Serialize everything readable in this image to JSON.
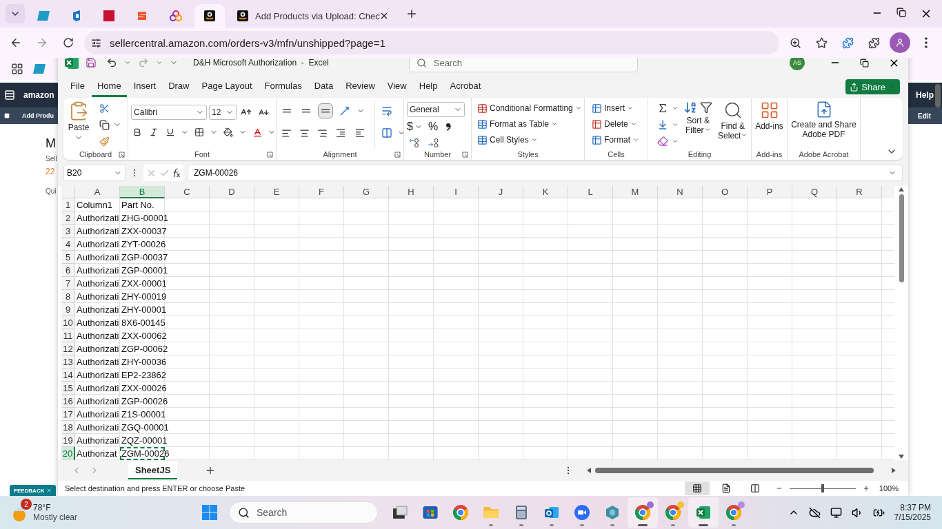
{
  "browser": {
    "tabs": [
      {
        "kind": "ec",
        "selected": false
      },
      {
        "kind": "g",
        "selected": false
      },
      {
        "kind": "dh",
        "selected": false
      },
      {
        "kind": "s",
        "selected": false
      },
      {
        "kind": "dots",
        "selected": false
      },
      {
        "kind": "amazon",
        "selected": true
      },
      {
        "kind": "amazon",
        "selected": false,
        "title": "Add Products via Upload: Chec"
      }
    ],
    "url": "sellercentral.amazon.com/orders-v3/mfn/unshipped?page=1"
  },
  "page": {
    "brand": "amazon",
    "nav_right": "Help",
    "subnav": "Add Produ",
    "subnav_right": "Edit",
    "heading": "M",
    "label": "Sell",
    "count": "22",
    "quick": "Qui",
    "feedback": "FEEDBACK"
  },
  "excel": {
    "title": "D&H Microsoft Authorization  -  Excel",
    "search_placeholder": "Search",
    "avatar": "AS",
    "menu": [
      {
        "label": "File",
        "selected": false
      },
      {
        "label": "Home",
        "selected": true
      },
      {
        "label": "Insert",
        "selected": false
      },
      {
        "label": "Draw",
        "selected": false
      },
      {
        "label": "Page Layout",
        "selected": false
      },
      {
        "label": "Formulas",
        "selected": false
      },
      {
        "label": "Data",
        "selected": false
      },
      {
        "label": "Review",
        "selected": false
      },
      {
        "label": "View",
        "selected": false
      },
      {
        "label": "Help",
        "selected": false
      },
      {
        "label": "Acrobat",
        "selected": false
      }
    ],
    "share": "Share",
    "ribbon": [
      {
        "kind": "clipboard",
        "label": "Clipboard",
        "button": "Paste"
      },
      {
        "kind": "font",
        "label": "Font",
        "font_name": "Calibri",
        "font_size": "12"
      },
      {
        "kind": "alignment",
        "label": "Alignment"
      },
      {
        "kind": "number",
        "label": "Number",
        "format": "General",
        "currency": "$",
        "percent": "%"
      },
      {
        "kind": "styles",
        "label": "Styles",
        "items": [
          "Conditional Formatting",
          "Format as Table",
          "Cell Styles"
        ]
      },
      {
        "kind": "cells",
        "label": "Cells",
        "items": [
          "Insert",
          "Delete",
          "Format"
        ]
      },
      {
        "kind": "editing",
        "label": "Editing",
        "items": [
          "Sort & Filter",
          "Find & Select"
        ]
      },
      {
        "kind": "addins",
        "label": "Add-ins",
        "button": "Add-ins"
      },
      {
        "kind": "acrobat",
        "label": "Adobe Acrobat",
        "button": "Create and Share Adobe PDF"
      }
    ],
    "name_box": "B20",
    "formula": "ZGM-00026",
    "columns": [
      {
        "label": "A",
        "selected": false
      },
      {
        "label": "B",
        "selected": true
      },
      {
        "label": "C",
        "selected": false
      },
      {
        "label": "D",
        "selected": false
      },
      {
        "label": "E",
        "selected": false
      },
      {
        "label": "F",
        "selected": false
      },
      {
        "label": "G",
        "selected": false
      },
      {
        "label": "H",
        "selected": false
      },
      {
        "label": "I",
        "selected": false
      },
      {
        "label": "J",
        "selected": false
      },
      {
        "label": "K",
        "selected": false
      },
      {
        "label": "L",
        "selected": false
      },
      {
        "label": "M",
        "selected": false
      },
      {
        "label": "N",
        "selected": false
      },
      {
        "label": "O",
        "selected": false
      },
      {
        "label": "P",
        "selected": false
      },
      {
        "label": "Q",
        "selected": false
      },
      {
        "label": "R",
        "selected": false
      }
    ],
    "rows": [
      {
        "header": "1",
        "selected": false,
        "cells": [
          {
            "text": "Column1",
            "selected": false
          },
          {
            "text": "Part No.",
            "selected": false
          }
        ]
      },
      {
        "header": "2",
        "selected": false,
        "cells": [
          {
            "text": "Authorizati",
            "selected": false
          },
          {
            "text": "ZHG-00001",
            "selected": false
          }
        ]
      },
      {
        "header": "3",
        "selected": false,
        "cells": [
          {
            "text": "Authorizati",
            "selected": false
          },
          {
            "text": "ZXX-00037",
            "selected": false
          }
        ]
      },
      {
        "header": "4",
        "selected": false,
        "cells": [
          {
            "text": "Authorizati",
            "selected": false
          },
          {
            "text": "ZYT-00026",
            "selected": false
          }
        ]
      },
      {
        "header": "5",
        "selected": false,
        "cells": [
          {
            "text": "Authorizati",
            "selected": false
          },
          {
            "text": "ZGP-00037",
            "selected": false
          }
        ]
      },
      {
        "header": "6",
        "selected": false,
        "cells": [
          {
            "text": "Authorizati",
            "selected": false
          },
          {
            "text": "ZGP-00001",
            "selected": false
          }
        ]
      },
      {
        "header": "7",
        "selected": false,
        "cells": [
          {
            "text": "Authorizati",
            "selected": false
          },
          {
            "text": "ZXX-00001",
            "selected": false
          }
        ]
      },
      {
        "header": "8",
        "selected": false,
        "cells": [
          {
            "text": "Authorizati",
            "selected": false
          },
          {
            "text": "ZHY-00019",
            "selected": false
          }
        ]
      },
      {
        "header": "9",
        "selected": false,
        "cells": [
          {
            "text": "Authorizati",
            "selected": false
          },
          {
            "text": "ZHY-00001",
            "selected": false
          }
        ]
      },
      {
        "header": "10",
        "selected": false,
        "cells": [
          {
            "text": "Authorizati",
            "selected": false
          },
          {
            "text": "8X6-00145",
            "selected": false
          }
        ]
      },
      {
        "header": "11",
        "selected": false,
        "cells": [
          {
            "text": "Authorizati",
            "selected": false
          },
          {
            "text": "ZXX-00062",
            "selected": false
          }
        ]
      },
      {
        "header": "12",
        "selected": false,
        "cells": [
          {
            "text": "Authorizati",
            "selected": false
          },
          {
            "text": "ZGP-00062",
            "selected": false
          }
        ]
      },
      {
        "header": "13",
        "selected": false,
        "cells": [
          {
            "text": "Authorizati",
            "selected": false
          },
          {
            "text": "ZHY-00036",
            "selected": false
          }
        ]
      },
      {
        "header": "14",
        "selected": false,
        "cells": [
          {
            "text": "Authorizati",
            "selected": false
          },
          {
            "text": "EP2-23862",
            "selected": false
          }
        ]
      },
      {
        "header": "15",
        "selected": false,
        "cells": [
          {
            "text": "Authorizati",
            "selected": false
          },
          {
            "text": "ZXX-00026",
            "selected": false
          }
        ]
      },
      {
        "header": "16",
        "selected": false,
        "cells": [
          {
            "text": "Authorizati",
            "selected": false
          },
          {
            "text": "ZGP-00026",
            "selected": false
          }
        ]
      },
      {
        "header": "17",
        "selected": false,
        "cells": [
          {
            "text": "Authorizati",
            "selected": false
          },
          {
            "text": "Z1S-00001",
            "selected": false
          }
        ]
      },
      {
        "header": "18",
        "selected": false,
        "cells": [
          {
            "text": "Authorizati",
            "selected": false
          },
          {
            "text": "ZGQ-00001",
            "selected": false
          }
        ]
      },
      {
        "header": "19",
        "selected": false,
        "cells": [
          {
            "text": "Authorizati",
            "selected": false
          },
          {
            "text": "ZQZ-00001",
            "selected": false
          }
        ]
      },
      {
        "header": "20",
        "selected": true,
        "cells": [
          {
            "text": "Authorizat",
            "selected": false
          },
          {
            "text": "ZGM-00026",
            "selected": true
          }
        ]
      }
    ],
    "sheets": [
      {
        "label": "SheetJS",
        "selected": true
      }
    ],
    "status": "Select destination and press ENTER or choose Paste",
    "view_modes": [
      {
        "kind": "normal",
        "selected": true
      },
      {
        "kind": "layout",
        "selected": false
      },
      {
        "kind": "pagebreak",
        "selected": false
      }
    ],
    "zoom": {
      "level": 0.5,
      "reading": "100%"
    }
  },
  "taskbar": {
    "weather": {
      "temp": "78°F",
      "condition": "Mostly clear",
      "badge": "2"
    },
    "search_placeholder": "Search",
    "apps": [
      {
        "kind": "taskview",
        "running": false,
        "active": false
      },
      {
        "kind": "store",
        "running": false,
        "active": false
      },
      {
        "kind": "chrome",
        "running": false,
        "active": false
      },
      {
        "kind": "files",
        "running": true,
        "active": false
      },
      {
        "kind": "calculator",
        "running": true,
        "active": false
      },
      {
        "kind": "outlook",
        "running": true,
        "active": false
      },
      {
        "kind": "zoom",
        "running": true,
        "active": false
      },
      {
        "kind": "hexagon",
        "running": true,
        "active": false
      },
      {
        "kind": "chrome",
        "running": true,
        "active": true,
        "color": "#9b6fd6"
      },
      {
        "kind": "chrome",
        "running": true,
        "active": false,
        "color": "#f2c230"
      },
      {
        "kind": "excel",
        "running": true,
        "active": true
      },
      {
        "kind": "chrome",
        "running": true,
        "active": false,
        "color": "#b48be8"
      }
    ],
    "time": "8:37 PM",
    "date": "7/15/2025"
  }
}
